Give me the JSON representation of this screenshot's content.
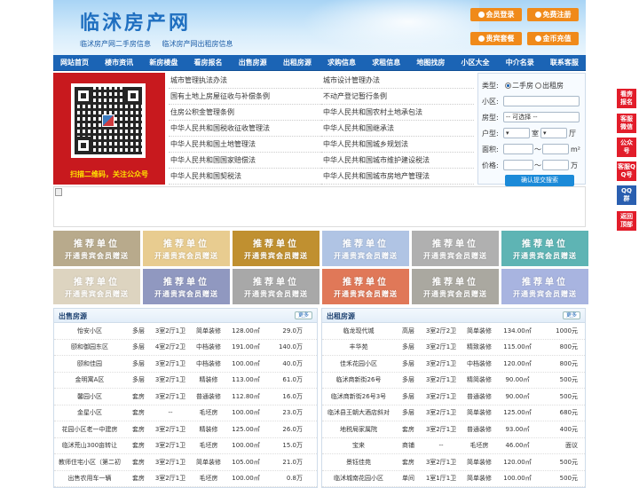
{
  "site": {
    "logo": "临沭房产网",
    "sub1": "临沭房产网二手房信息",
    "sub2": "临沭房产网出租房信息"
  },
  "header_buttons": [
    {
      "label": "会员登录"
    },
    {
      "label": "免费注册"
    },
    {
      "label": "贵宾套餐"
    },
    {
      "label": "金币充值"
    }
  ],
  "nav": [
    "网站首页",
    "楼市资讯",
    "新房楼盘",
    "看房报名",
    "出售房源",
    "出租房源",
    "求购信息",
    "求租信息",
    "地图找房",
    "小区大全",
    "中介名录",
    "联系客服"
  ],
  "qr": {
    "caption": "扫描二维码，关注公众号"
  },
  "links": [
    "城市管理执法办法",
    "城市设计管理办法",
    "国有土地上房屋征收与补偿条例",
    "不动产登记暂行条例",
    "住房公积金管理条例",
    "中华人民共和国农村土地承包法",
    "中华人民共和国税收征收管理法",
    "中华人民共和国继承法",
    "中华人民共和国土地管理法",
    "中华人民共和国城乡规划法",
    "中华人民共和国国家赔偿法",
    "中华人民共和国城市维护建设税法",
    "中华人民共和国契税法",
    "中华人民共和国城市房地产管理法"
  ],
  "search": {
    "type_label": "类型:",
    "opt1": "二手房",
    "opt2": "出租房",
    "community_label": "小区:",
    "house_label": "房型:",
    "house_value": "-- 可选择 --",
    "layout_label": "户型:",
    "layout_room": "室",
    "layout_hall": "厅",
    "area_label": "面积:",
    "area_to": "～",
    "area_unit": "m²",
    "price_label": "价格:",
    "price_to": "～",
    "price_unit": "万",
    "submit": "确认提交搜索"
  },
  "ads": [
    {
      "t1": "推荐单位",
      "t2": "开通贵宾会员赠送",
      "color": "#b8aa8c"
    },
    {
      "t1": "推荐单位",
      "t2": "开通贵宾会员赠送",
      "color": "#e8cc90"
    },
    {
      "t1": "推荐单位",
      "t2": "开通贵宾会员赠送",
      "color": "#c09030"
    },
    {
      "t1": "推荐单位",
      "t2": "开通贵宾会员赠送",
      "color": "#b0c4e4"
    },
    {
      "t1": "推荐单位",
      "t2": "开通贵宾会员赠送",
      "color": "#b0b0b0"
    },
    {
      "t1": "推荐单位",
      "t2": "开通贵宾会员赠送",
      "color": "#5eb4b4"
    },
    {
      "t1": "推荐单位",
      "t2": "开通贵宾会员赠送",
      "color": "#ddd4c0"
    },
    {
      "t1": "推荐单位",
      "t2": "开通贵宾会员赠送",
      "color": "#9098c0"
    },
    {
      "t1": "推荐单位",
      "t2": "开通贵宾会员赠送",
      "color": "#a8a8a8"
    },
    {
      "t1": "推荐单位",
      "t2": "开通贵宾会员赠送",
      "color": "#e07858"
    },
    {
      "t1": "推荐单位",
      "t2": "开通贵宾会员赠送",
      "color": "#aaa8a0"
    },
    {
      "t1": "推荐单位",
      "t2": "开通贵宾会员赠送",
      "color": "#a8b4e0"
    }
  ],
  "sale": {
    "title": "出售房源",
    "more": "更多",
    "rows": [
      [
        "怡安小区",
        "多层",
        "3室2厅1卫",
        "简单装修",
        "128.00㎡",
        "29.0万"
      ],
      [
        "颐和御园东区",
        "多层",
        "4室2厅2卫",
        "中档装修",
        "191.00㎡",
        "140.0万"
      ],
      [
        "颐和佳园",
        "多层",
        "3室2厅1卫",
        "中档装修",
        "100.00㎡",
        "40.0万"
      ],
      [
        "金明寓A区",
        "多层",
        "3室2厅1卫",
        "精装修",
        "113.00㎡",
        "61.0万"
      ],
      [
        "馨园小区",
        "套房",
        "3室2厅1卫",
        "普通装修",
        "112.80㎡",
        "16.0万"
      ],
      [
        "金星小区",
        "套房",
        "--",
        "毛坯房",
        "100.00㎡",
        "23.0万"
      ],
      [
        "花园小区老一中建房",
        "套房",
        "3室2厅1卫",
        "精装修",
        "125.00㎡",
        "26.0万"
      ],
      [
        "临沭荒山300亩转让",
        "套房",
        "3室2厅1卫",
        "毛坯房",
        "100.00㎡",
        "15.0万"
      ],
      [
        "教师住宅小区（第二初",
        "套房",
        "3室2厅1卫",
        "简单装修",
        "105.00㎡",
        "21.0万"
      ],
      [
        "出售农用车一辆",
        "套房",
        "3室2厅1卫",
        "毛坯房",
        "100.00㎡",
        "0.8万"
      ]
    ]
  },
  "rent": {
    "title": "出租房源",
    "more": "更多",
    "rows": [
      [
        "临龙现代城",
        "高层",
        "3室2厅2卫",
        "简单装修",
        "134.00㎡",
        "1000元"
      ],
      [
        "丰华苑",
        "多层",
        "3室2厅1卫",
        "精致装修",
        "115.00㎡",
        "800元"
      ],
      [
        "佳禾花园小区",
        "多层",
        "3室2厅1卫",
        "中档装修",
        "120.00㎡",
        "800元"
      ],
      [
        "临沭商新街26号",
        "多层",
        "3室2厅1卫",
        "精简装修",
        "90.00㎡",
        "500元"
      ],
      [
        "临沭商新街26号3号",
        "多层",
        "3室2厅1卫",
        "普通装修",
        "90.00㎡",
        "500元"
      ],
      [
        "临沭县王朝大酒店斜对",
        "多层",
        "3室2厅1卫",
        "简单装修",
        "125.00㎡",
        "680元"
      ],
      [
        "地税局家属院",
        "套房",
        "3室2厅1卫",
        "普通装修",
        "93.00㎡",
        "400元"
      ],
      [
        "宝来",
        "商铺",
        "--",
        "毛坯房",
        "46.00㎡",
        "面议"
      ],
      [
        "景钰佳苑",
        "套房",
        "3室2厅1卫",
        "简单装修",
        "120.00㎡",
        "500元"
      ],
      [
        "临沭城南花园小区",
        "单间",
        "1室1厅1卫",
        "简单装修",
        "100.00㎡",
        "500元"
      ]
    ]
  },
  "float": [
    "看房报名",
    "客服微信",
    "公众号",
    "客服QQ号",
    "QQ群",
    "返回顶部"
  ]
}
